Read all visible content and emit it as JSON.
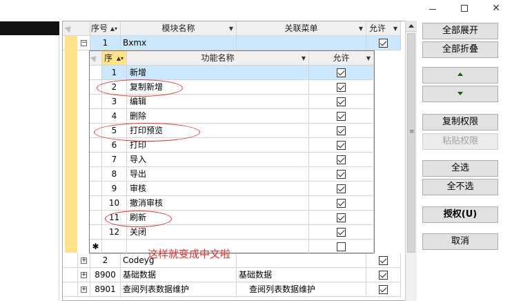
{
  "window": {
    "minimize_glyph": "—",
    "close_glyph": "✕"
  },
  "main_grid": {
    "headers": {
      "seq": "序号",
      "module": "模块名称",
      "menu": "关联菜单",
      "allow": "允许"
    },
    "expanded_row": {
      "seq": "1",
      "module": "Bxmx",
      "allow": true
    },
    "rows_below": [
      {
        "seq": "2",
        "module": "Codeyg",
        "menu": "",
        "allow": true
      },
      {
        "seq": "8900",
        "module": "基础数据",
        "menu": "基础数据",
        "allow": true
      },
      {
        "seq": "8901",
        "module": "查阅列表数据维护",
        "menu": "查阅列表数据维护",
        "allow": true
      }
    ]
  },
  "detail_grid": {
    "headers": {
      "seq": "序",
      "func": "功能名称",
      "allow": "允许"
    },
    "rows": [
      {
        "seq": "1",
        "func": "新增",
        "allow": true
      },
      {
        "seq": "2",
        "func": "复制新增",
        "allow": true
      },
      {
        "seq": "3",
        "func": "编辑",
        "allow": true
      },
      {
        "seq": "4",
        "func": "删除",
        "allow": true
      },
      {
        "seq": "5",
        "func": "打印预览",
        "allow": true
      },
      {
        "seq": "6",
        "func": "打印",
        "allow": true
      },
      {
        "seq": "7",
        "func": "导入",
        "allow": true
      },
      {
        "seq": "8",
        "func": "导出",
        "allow": true
      },
      {
        "seq": "9",
        "func": "审核",
        "allow": true
      },
      {
        "seq": "10",
        "func": "撤消审核",
        "allow": true
      },
      {
        "seq": "11",
        "func": "刷新",
        "allow": true
      },
      {
        "seq": "12",
        "func": "关闭",
        "allow": true
      }
    ],
    "new_row_marker": "✱"
  },
  "annotation": {
    "text": "这样就变成中文啦",
    "color": "#e03030"
  },
  "buttons": {
    "expand_all": "全部展开",
    "collapse_all": "全部折叠",
    "copy_perm": "复制权限",
    "paste_perm": "粘贴权限",
    "select_all": "全选",
    "select_none": "全不选",
    "authorize": "授权(U)",
    "cancel": "取消"
  },
  "colors": {
    "selected_row": "#cce8ff",
    "yellow_strip": "#ffe28a",
    "grid_header": "#f0f0f0"
  }
}
